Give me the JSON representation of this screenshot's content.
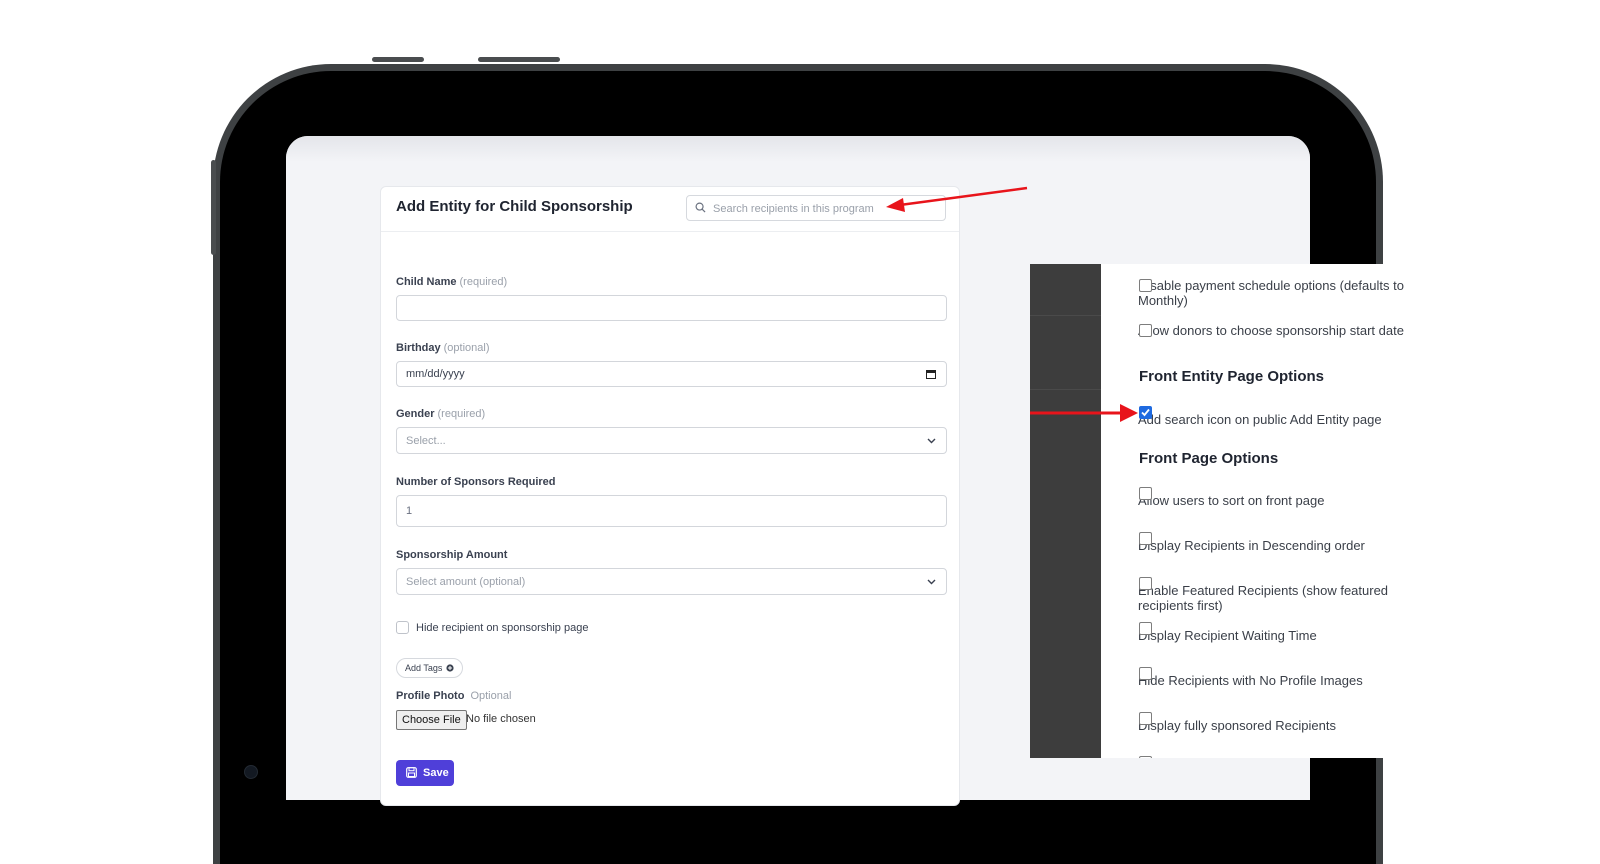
{
  "form": {
    "title": "Add Entity for Child Sponsorship",
    "search_placeholder": "Search recipients in this program",
    "child_name": {
      "label": "Child Name",
      "hint": "(required)",
      "value": ""
    },
    "birthday": {
      "label": "Birthday",
      "hint": "(optional)",
      "placeholder": "mm/dd/yyyy"
    },
    "gender": {
      "label": "Gender",
      "hint": "(required)",
      "selected": "Select..."
    },
    "sponsors_required": {
      "label": "Number of Sponsors Required",
      "value": "1"
    },
    "sponsorship_amount": {
      "label": "Sponsorship Amount",
      "selected": "Select amount (optional)"
    },
    "hide_recipient": {
      "label": "Hide recipient on sponsorship page",
      "checked": false
    },
    "add_tags_label": "Add Tags",
    "profile_photo": {
      "label": "Profile Photo",
      "hint": "Optional",
      "button": "Choose File",
      "status": "No file chosen"
    },
    "save_label": "Save"
  },
  "settings": {
    "opt_disable_schedule": "Disable payment schedule options (defaults to Monthly)",
    "opt_start_date": "Allow donors to choose sponsorship start date",
    "front_entity_title": "Front Entity Page Options",
    "opt_search_icon": "Add search icon on public Add Entity page",
    "front_page_title": "Front Page Options",
    "opt_sort": "Allow users to sort on front page",
    "opt_descending": "Display Recipients in Descending order",
    "opt_featured": "Enable Featured Recipients (show featured recipients first)",
    "opt_waiting": "Display Recipient Waiting Time",
    "opt_no_images": "Hide Recipients with No Profile Images",
    "opt_fully_sponsored": "Display fully sponsored Recipients"
  },
  "colors": {
    "primary": "#4f3fd9",
    "annotation_arrow": "#e8141b",
    "checked": "#1f6ae0"
  }
}
